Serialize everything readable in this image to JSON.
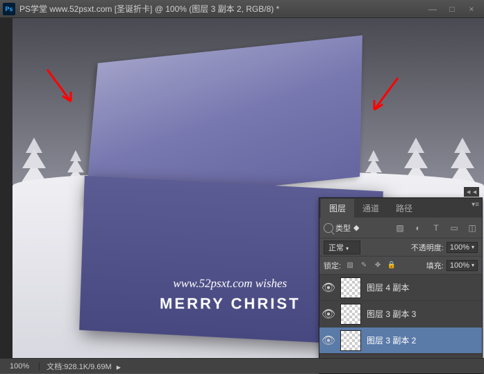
{
  "titlebar": {
    "appLogo": "Ps",
    "title": "PS学堂  www.52psxt.com [圣诞折卡] @ 100% (图层 3 副本 2, RGB/8) *"
  },
  "canvas": {
    "wishesLine": "www.52psxt.com   wishes",
    "merryLine": "MERRY CHRIST"
  },
  "statusbar": {
    "zoom": "100%",
    "docLabel": "文档:",
    "docValue": "928.1K/9.69M"
  },
  "panel": {
    "tabs": {
      "layers": "图层",
      "channels": "通道",
      "paths": "路径"
    },
    "filterLabel": "类型",
    "filterIcons": [
      "image-icon",
      "adjustment-icon",
      "text-icon",
      "shape-icon",
      "smartobj-icon"
    ],
    "blendMode": "正常",
    "opacityLabel": "不透明度:",
    "opacityValue": "100%",
    "lockLabel": "锁定:",
    "fillLabel": "填充:",
    "fillValue": "100%",
    "layers": [
      {
        "name": "图层 4 副本",
        "selected": false
      },
      {
        "name": "图层 3 副本 3",
        "selected": false
      },
      {
        "name": "图层 3 副本 2",
        "selected": true
      }
    ],
    "footerIcons": [
      "link-icon",
      "fx-icon",
      "mask-icon",
      "adjustlayer-icon",
      "group-icon",
      "newlayer-icon",
      "trash-icon"
    ]
  }
}
